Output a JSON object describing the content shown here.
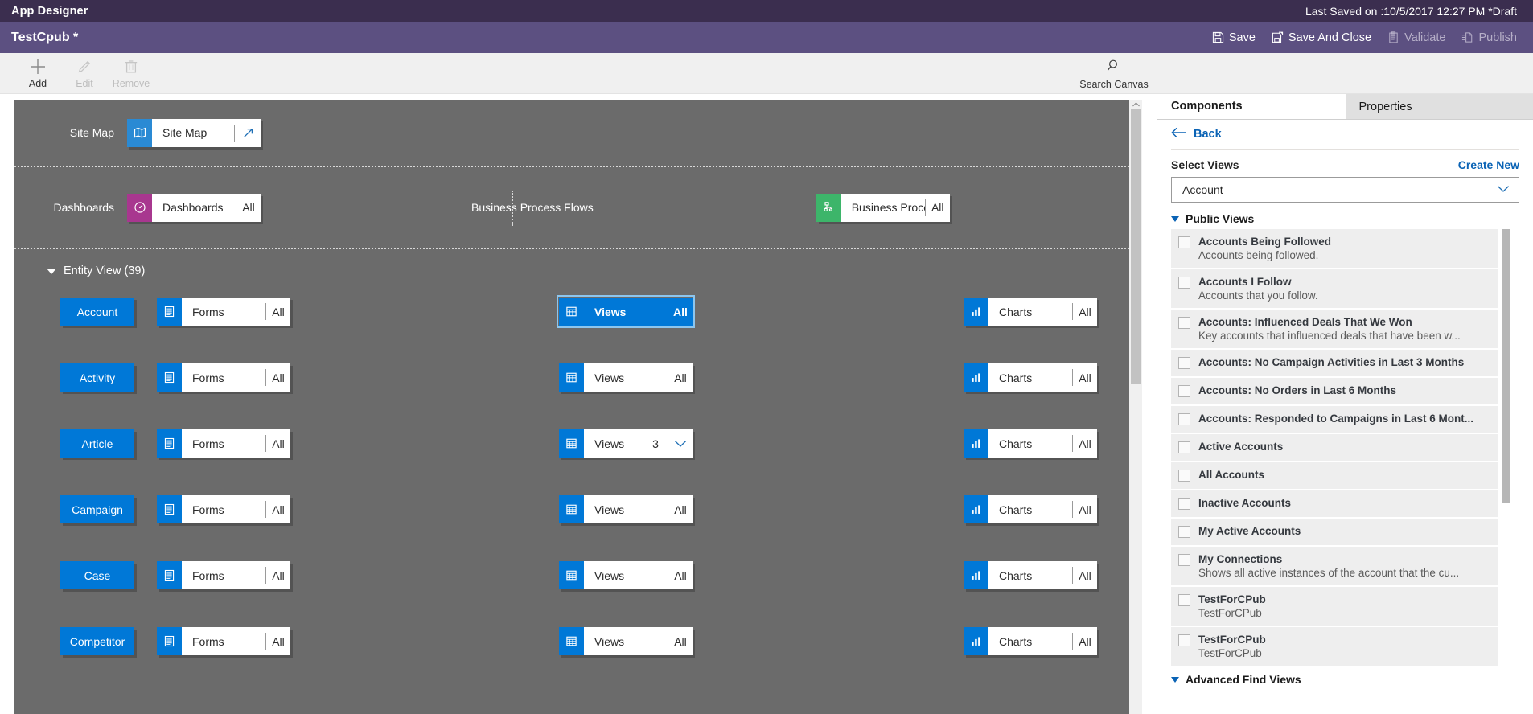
{
  "titlebar": {
    "app_title": "App Designer",
    "last_saved": "Last Saved on :10/5/2017 12:27 PM *Draft"
  },
  "commandbar": {
    "doc_name": "TestCpub *",
    "actions": [
      {
        "label": "Save",
        "icon": "save-icon",
        "disabled": false
      },
      {
        "label": "Save And Close",
        "icon": "save-and-close-icon",
        "disabled": false
      },
      {
        "label": "Validate",
        "icon": "validate-icon",
        "disabled": true
      },
      {
        "label": "Publish",
        "icon": "publish-icon",
        "disabled": true
      }
    ]
  },
  "ribbon": {
    "buttons": [
      {
        "label": "Add",
        "icon": "plus-icon",
        "disabled": false
      },
      {
        "label": "Edit",
        "icon": "pencil-icon",
        "disabled": true
      },
      {
        "label": "Remove",
        "icon": "trash-icon",
        "disabled": true
      }
    ],
    "search_canvas": {
      "label": "Search Canvas",
      "icon": "search-icon"
    }
  },
  "canvas": {
    "sitemap_zone": {
      "label": "Site Map",
      "tile": {
        "name": "Site Map",
        "icon": "sitemap-icon",
        "icon_color": "#2a8ad4",
        "action": "open-designer-icon"
      }
    },
    "dashboards_zone": {
      "label": "Dashboards",
      "tile": {
        "name": "Dashboards",
        "icon": "dashboard-icon",
        "icon_color": "#a8378f",
        "count": "All"
      }
    },
    "bpf_zone": {
      "label": "Business Process Flows",
      "tile": {
        "name": "Business Proces...",
        "icon": "process-flow-icon",
        "icon_color": "#3db56a",
        "count": "All"
      }
    },
    "entity_view": {
      "title": "Entity View (39)",
      "rows": [
        {
          "entity": "Account",
          "forms": {
            "name": "Forms",
            "count": "All",
            "selected": false
          },
          "views": {
            "name": "Views",
            "count": "All",
            "selected": true
          },
          "charts": {
            "name": "Charts",
            "count": "All",
            "selected": false
          }
        },
        {
          "entity": "Activity",
          "forms": {
            "name": "Forms",
            "count": "All",
            "selected": false
          },
          "views": {
            "name": "Views",
            "count": "All",
            "selected": false
          },
          "charts": {
            "name": "Charts",
            "count": "All",
            "selected": false
          }
        },
        {
          "entity": "Article",
          "forms": {
            "name": "Forms",
            "count": "All",
            "selected": false
          },
          "views": {
            "name": "Views",
            "count": "3",
            "has_chevron": true,
            "selected": false
          },
          "charts": {
            "name": "Charts",
            "count": "All",
            "selected": false
          }
        },
        {
          "entity": "Campaign",
          "forms": {
            "name": "Forms",
            "count": "All",
            "selected": false
          },
          "views": {
            "name": "Views",
            "count": "All",
            "selected": false
          },
          "charts": {
            "name": "Charts",
            "count": "All",
            "selected": false
          }
        },
        {
          "entity": "Case",
          "forms": {
            "name": "Forms",
            "count": "All",
            "selected": false
          },
          "views": {
            "name": "Views",
            "count": "All",
            "selected": false
          },
          "charts": {
            "name": "Charts",
            "count": "All",
            "selected": false
          }
        },
        {
          "entity": "Competitor",
          "forms": {
            "name": "Forms",
            "count": "All",
            "selected": false
          },
          "views": {
            "name": "Views",
            "count": "All",
            "selected": false
          },
          "charts": {
            "name": "Charts",
            "count": "All",
            "selected": false
          }
        }
      ]
    }
  },
  "panel": {
    "tabs": [
      {
        "label": "Components",
        "active": true
      },
      {
        "label": "Properties",
        "active": false
      }
    ],
    "back_label": "Back",
    "select_views_label": "Select Views",
    "create_new_label": "Create New",
    "entity_combo_value": "Account",
    "groups": [
      {
        "title": "Public Views",
        "items": [
          {
            "title": "Accounts Being Followed",
            "desc": "Accounts being followed.",
            "checked": false
          },
          {
            "title": "Accounts I Follow",
            "desc": "Accounts that you follow.",
            "checked": false
          },
          {
            "title": "Accounts: Influenced Deals That We Won",
            "desc": "Key accounts that influenced deals that have been w...",
            "checked": false
          },
          {
            "title": "Accounts: No Campaign Activities in Last 3 Months",
            "desc": "",
            "checked": false
          },
          {
            "title": "Accounts: No Orders in Last 6 Months",
            "desc": "",
            "checked": false
          },
          {
            "title": "Accounts: Responded to Campaigns in Last 6 Mont...",
            "desc": "",
            "checked": false
          },
          {
            "title": "Active Accounts",
            "desc": "",
            "checked": false
          },
          {
            "title": "All Accounts",
            "desc": "",
            "checked": false
          },
          {
            "title": "Inactive Accounts",
            "desc": "",
            "checked": false
          },
          {
            "title": "My Active Accounts",
            "desc": "",
            "checked": false
          },
          {
            "title": "My Connections",
            "desc": "Shows all active instances of the account that the cu...",
            "checked": false
          },
          {
            "title": "TestForCPub",
            "desc": "TestForCPub",
            "checked": false
          },
          {
            "title": "TestForCPub",
            "desc": "TestForCPub",
            "checked": false
          }
        ]
      },
      {
        "title": "Advanced Find Views",
        "items": []
      }
    ]
  },
  "colors": {
    "titlebar": "#3b2e4f",
    "commandbar": "#5c5081",
    "canvas": "#6b6b6b",
    "accent_blue": "#0078d7",
    "link_blue": "#0a63b5"
  }
}
